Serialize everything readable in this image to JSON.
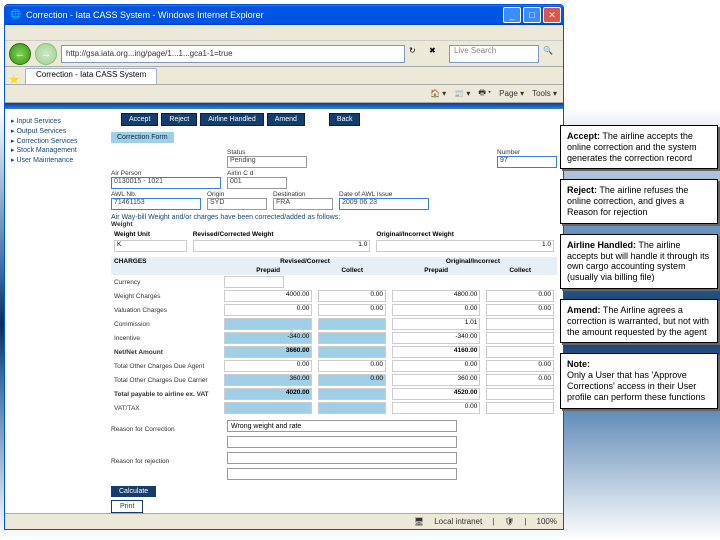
{
  "window": {
    "title": "Correction - Iata CASS System - Windows Internet Explorer",
    "address": "http://gsa.iata.org...ing/page/1...1...gca1-1=true",
    "search_placeholder": "Live Search",
    "tab_label": "Correction - Iata CASS System",
    "sub_toolbar": {
      "page": "Page ▾",
      "tools": "Tools ▾"
    },
    "status": {
      "zone": "Local intranet",
      "zoom": "100%"
    }
  },
  "sidebar": {
    "items": [
      "▸ Input Services",
      "▸ Output Services",
      "▸ Correction Services",
      "▸ Stock Management",
      "▸ User Maintenance"
    ]
  },
  "actions": {
    "accept": "Accept",
    "reject": "Reject",
    "airline_handled": "Airline Handled",
    "amend": "Amend",
    "back": "Back"
  },
  "form": {
    "title": "Correction Form",
    "status_label": "Status",
    "status_value": "Pending",
    "number_label": "Number",
    "number_value": "97",
    "airperson_label": "Air Person",
    "airperson_value": "0130015 - 1021",
    "airline_label": "Airlin C d",
    "airline_value": "001",
    "awb_label": "AWL Nb.",
    "awb_value": "71461153",
    "origin_label": "Origin",
    "origin_value": "SYD",
    "dest_label": "Destination",
    "dest_value": "FRA",
    "date_label": "Date of AWL Issue",
    "date_value": "2009 06 23",
    "section_text": "Air Way-bill Weight and/or charges have been corrected/added as follows:",
    "weight_header": "Weight",
    "wcol1": "Weight Unit",
    "wcol2": "Revised/Corrected Weight",
    "wcol3": "Original/Incorrect Weight",
    "weight_unit": "K",
    "weight_revised": "1.0",
    "weight_original": "1.0",
    "charges_header": "CHARGES",
    "col_rev_prepaid": "Prepaid",
    "col_rev_collect": "Collect",
    "col_rev_h": "Revised/Correct",
    "col_orig_h": "Original/Incorrect",
    "rows": {
      "currency": {
        "label": "Currency",
        "val": ""
      },
      "weight_charges": {
        "label": "Weight Charges",
        "rp": "4000.00",
        "rc": "0.00",
        "op": "4800.00",
        "oc": "0.00"
      },
      "valuation": {
        "label": "Valuation Charges",
        "rp": "0.00",
        "rc": "0.00",
        "op": "0.00",
        "oc": "0.00"
      },
      "commission": {
        "label": "Commission",
        "rp": "",
        "rc": "",
        "op": "1.01",
        "oc": ""
      },
      "incentive": {
        "label": "Incentive",
        "rp": "-340.00",
        "rc": "",
        "op": "-340.00",
        "oc": ""
      },
      "net": {
        "label": "Net/Net Amount",
        "rp": "3660.00",
        "rc": "",
        "op": "4160.00",
        "oc": ""
      },
      "due_agent": {
        "label": "Total Other Charges Due Agent",
        "rp": "0.00",
        "rc": "0.00",
        "op": "0.00",
        "oc": "0.00"
      },
      "due_carrier": {
        "label": "Total Other Charges Due Carrier",
        "rp": "360.00",
        "rc": "0.00",
        "op": "360.00",
        "oc": "0.00"
      },
      "total": {
        "label": "Total payable to airline ex. VAT",
        "rp": "4020.00",
        "rc": "",
        "op": "4520.00",
        "oc": ""
      },
      "vat": {
        "label": "VAT/TAX",
        "rp": "",
        "rc": "",
        "op": "0.00",
        "oc": ""
      }
    },
    "reason_corr_label": "Reason for Correction",
    "reason_corr_value": "Wrong weight and rate",
    "reason_rej_label": "Reason for rejection",
    "calc_btn": "Calculate",
    "print_btn": "Print"
  },
  "callouts": {
    "accept": {
      "h": "Accept:",
      "t": " The airline accepts the online correction and the system generates the correction record"
    },
    "reject": {
      "h": "Reject:",
      "t": " The airline refuses the online correction, and gives a Reason for rejection"
    },
    "airline": {
      "h": "Airline Handled:",
      "t": " The airline accepts but will handle it through its own cargo accounting system (usually via billing file)"
    },
    "amend": {
      "h": "Amend:",
      "t": " The Airline agrees a correction is warranted, but not with the amount requested by the agent"
    },
    "note": {
      "h": "Note:",
      "t": "Only a User that has 'Approve Corrections' access in their User profile can perform these functions"
    }
  }
}
